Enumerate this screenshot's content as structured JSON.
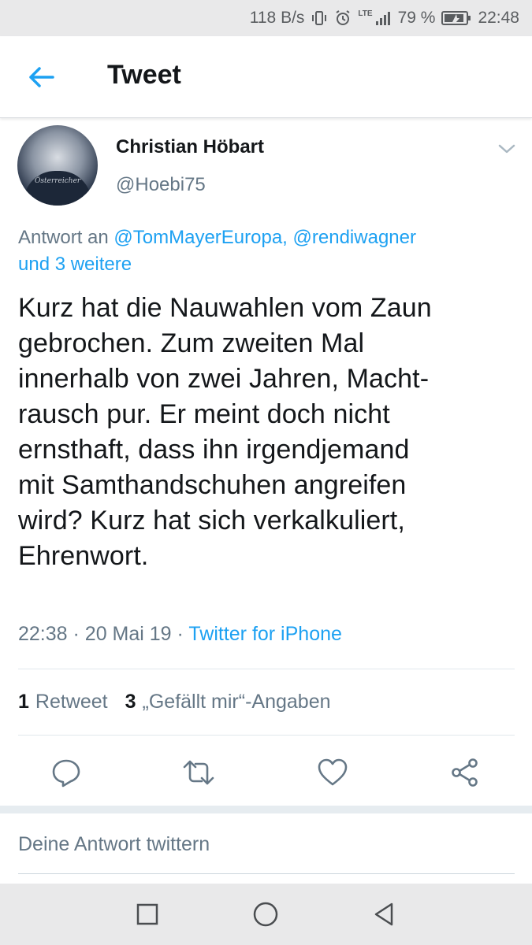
{
  "status_bar": {
    "net_speed": "118 B/s",
    "network_label": "LTE",
    "battery_percent": "79 %",
    "time": "22:48"
  },
  "header": {
    "title": "Tweet"
  },
  "tweet": {
    "author_name": "Christian Höbart",
    "author_handle": "@Hoebi75",
    "avatar_text": "Österreicher",
    "reply_prefix": "Antwort an",
    "reply_mentions": [
      "@TomMayerEuropa,",
      "@rendiwagner"
    ],
    "reply_suffix": "und 3 weitere",
    "text": "Kurz hat die Nauwahlen vom Zaun\ngebrochen. Zum zweiten Mal\ninnerhalb von zwei Jahren, Macht-\nrausch pur. Er meint doch nicht\nernsthaft, dass ihn irgendjemand\nmit Samthandschuhen angreifen\nwird? Kurz hat sich verkalkuliert,\nEhrenwort.",
    "time": "22:38",
    "date": "20 Mai 19",
    "separator": "·",
    "source": "Twitter for iPhone",
    "retweet_count": "1",
    "retweet_label": "Retweet",
    "like_count": "3",
    "like_label": "„Gefällt mir“-Angaben"
  },
  "reply_box": {
    "placeholder": "Deine Antwort twittern"
  },
  "colors": {
    "accent": "#1da1f2",
    "secondary_text": "#657786",
    "primary_text": "#14171a"
  }
}
